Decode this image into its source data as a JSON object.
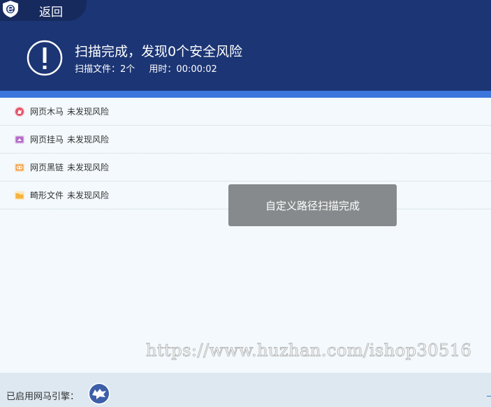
{
  "header": {
    "back_label": "返回",
    "title": "扫描完成，发现0个安全风险",
    "files_label": "扫描文件：2个",
    "time_label": "用时：00:00:02"
  },
  "results": [
    {
      "name": "网页木马",
      "status": "未发现风险",
      "icon": "trojan-icon",
      "color": "#e2576b"
    },
    {
      "name": "网页挂马",
      "status": "未发现风险",
      "icon": "hang-horse-icon",
      "color": "#b46cc8"
    },
    {
      "name": "网页黑链",
      "status": "未发现风险",
      "icon": "black-link-icon",
      "color": "#f0a04b"
    },
    {
      "name": "畸形文件",
      "status": "未发现风险",
      "icon": "folder-icon",
      "color": "#f5b23c"
    }
  ],
  "toast": {
    "text": "自定义路径扫描完成"
  },
  "watermark": {
    "text": "https://www.huzhan.com/ishop30516"
  },
  "footer": {
    "engine_label": "已启用网马引擎："
  }
}
